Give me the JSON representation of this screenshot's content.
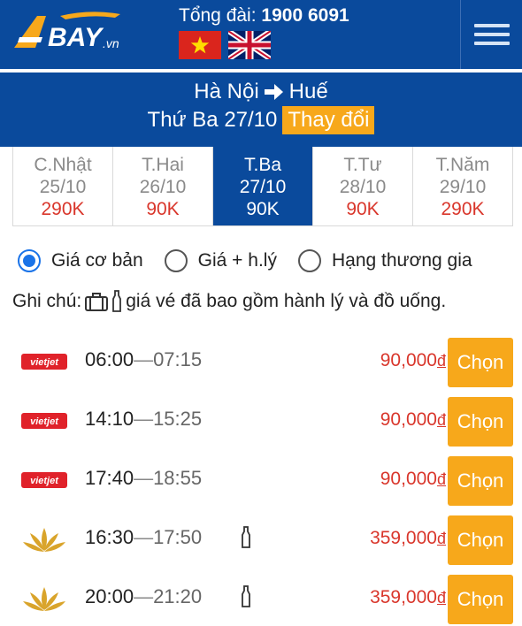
{
  "header": {
    "hotline_label": "Tổng đài:",
    "hotline_number": "1900 6091",
    "logo_text": "BAY",
    "logo_suffix": ".vn"
  },
  "route": {
    "origin": "Hà Nội",
    "destination": "Huế",
    "date": "Thứ Ba 27/10",
    "change_label": "Thay đổi"
  },
  "date_tabs": [
    {
      "day": "C.Nhật",
      "date": "25/10",
      "price": "290K"
    },
    {
      "day": "T.Hai",
      "date": "26/10",
      "price": "90K"
    },
    {
      "day": "T.Ba",
      "date": "27/10",
      "price": "90K"
    },
    {
      "day": "T.Tư",
      "date": "28/10",
      "price": "90K"
    },
    {
      "day": "T.Năm",
      "date": "29/10",
      "price": "290K"
    }
  ],
  "filters": {
    "basic": "Giá cơ bản",
    "with_baggage": "Giá + h.lý",
    "business": "Hạng thương gia"
  },
  "note": {
    "label": "Ghi chú:",
    "text": "giá vé đã bao gồm hành lý và đồ uống."
  },
  "choose_label": "Chọn",
  "currency_symbol": "đ",
  "flights": [
    {
      "airline": "vietjet",
      "logo_text": "vietjet",
      "depart": "06:00",
      "arrive": "07:15",
      "price": "90,000",
      "drink": false
    },
    {
      "airline": "vietjet",
      "logo_text": "vietjet",
      "depart": "14:10",
      "arrive": "15:25",
      "price": "90,000",
      "drink": false
    },
    {
      "airline": "vietjet",
      "logo_text": "vietjet",
      "depart": "17:40",
      "arrive": "18:55",
      "price": "90,000",
      "drink": false
    },
    {
      "airline": "vietnam-airlines",
      "depart": "16:30",
      "arrive": "17:50",
      "price": "359,000",
      "drink": true
    },
    {
      "airline": "vietnam-airlines",
      "depart": "20:00",
      "arrive": "21:20",
      "price": "359,000",
      "drink": true
    }
  ],
  "colors": {
    "brand_blue": "#0a4a9c",
    "accent_orange": "#f7a81b",
    "price_red": "#d9362b",
    "vietjet_red": "#e0222a",
    "lotus_gold": "#d9a42b"
  }
}
